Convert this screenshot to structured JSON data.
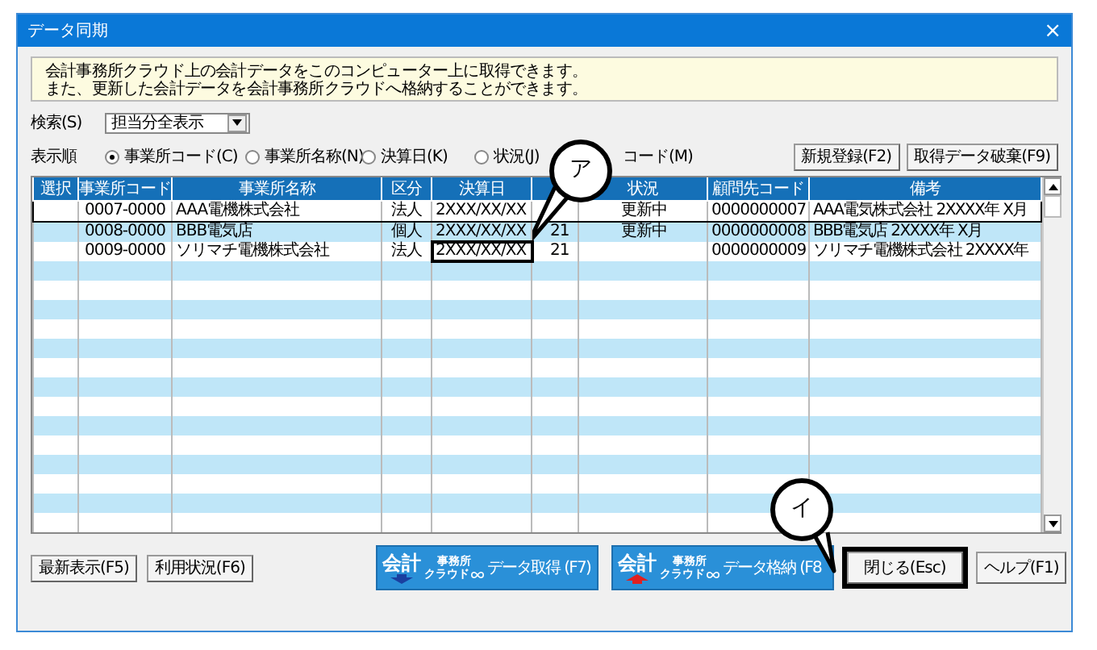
{
  "window": {
    "title": "データ同期",
    "close": "×"
  },
  "info": [
    "会計事務所クラウド上の会計データをこのコンピューター上に取得できます。",
    "また、更新した会計データを会計事務所クラウドへ格納することができます。"
  ],
  "search": {
    "label": "検索(S)",
    "value": "担当分全表示"
  },
  "sort": {
    "label": "表示順",
    "options": [
      {
        "label": "事業所コード(C)",
        "selected": true
      },
      {
        "label": "事業所名称(N)",
        "selected": false
      },
      {
        "label": "決算日(K)",
        "selected": false
      },
      {
        "label": "状況(J)",
        "selected": false
      }
    ],
    "partial_option": "コード(M)"
  },
  "top_buttons": [
    "新規登録(F2)",
    "取得データ破棄(F9)"
  ],
  "table": {
    "columns": [
      "選択",
      "事業所コード",
      "事業所名称",
      "区分",
      "決算日",
      "",
      "状況",
      "顧問先コード",
      "備考"
    ],
    "rows": [
      {
        "selected": true,
        "date_highlighted": false,
        "cells": [
          "",
          "0007-0000",
          "AAA電機株式会社",
          "法人",
          "2XXX/XX/XX",
          "",
          "更新中",
          "0000000007",
          "AAA電気株式会社 2XXXX年 X月"
        ]
      },
      {
        "selected": false,
        "date_highlighted": false,
        "cells": [
          "",
          "0008-0000",
          "BBB電気店",
          "個人",
          "2XXX/XX/XX",
          "21",
          "更新中",
          "0000000008",
          "BBB電気店 2XXXX年 X月"
        ]
      },
      {
        "selected": false,
        "date_highlighted": true,
        "cells": [
          "",
          "0009-0000",
          "ソリマチ電機株式会社",
          "法人",
          "2XXX/XX/XX",
          "21",
          "",
          "0000000009",
          "ソリマチ電機株式会社 2XXXX年"
        ]
      }
    ]
  },
  "bottom_left_buttons": [
    "最新表示(F5)",
    "利用状況(F6)"
  ],
  "cloud_buttons": [
    {
      "kind": "download",
      "logo": "会計",
      "logo_small": "事務所",
      "logo_tiny": "クラウド",
      "label": "データ取得 (F7)"
    },
    {
      "kind": "upload",
      "logo": "会計",
      "logo_small": "事務所",
      "logo_tiny": "クラウド",
      "label": "データ格納 (F8"
    }
  ],
  "close_button": {
    "label": "閉じる(Esc)",
    "highlighted": true
  },
  "help_button": "ヘルプ(F1)",
  "callouts": [
    "ア",
    "イ"
  ]
}
